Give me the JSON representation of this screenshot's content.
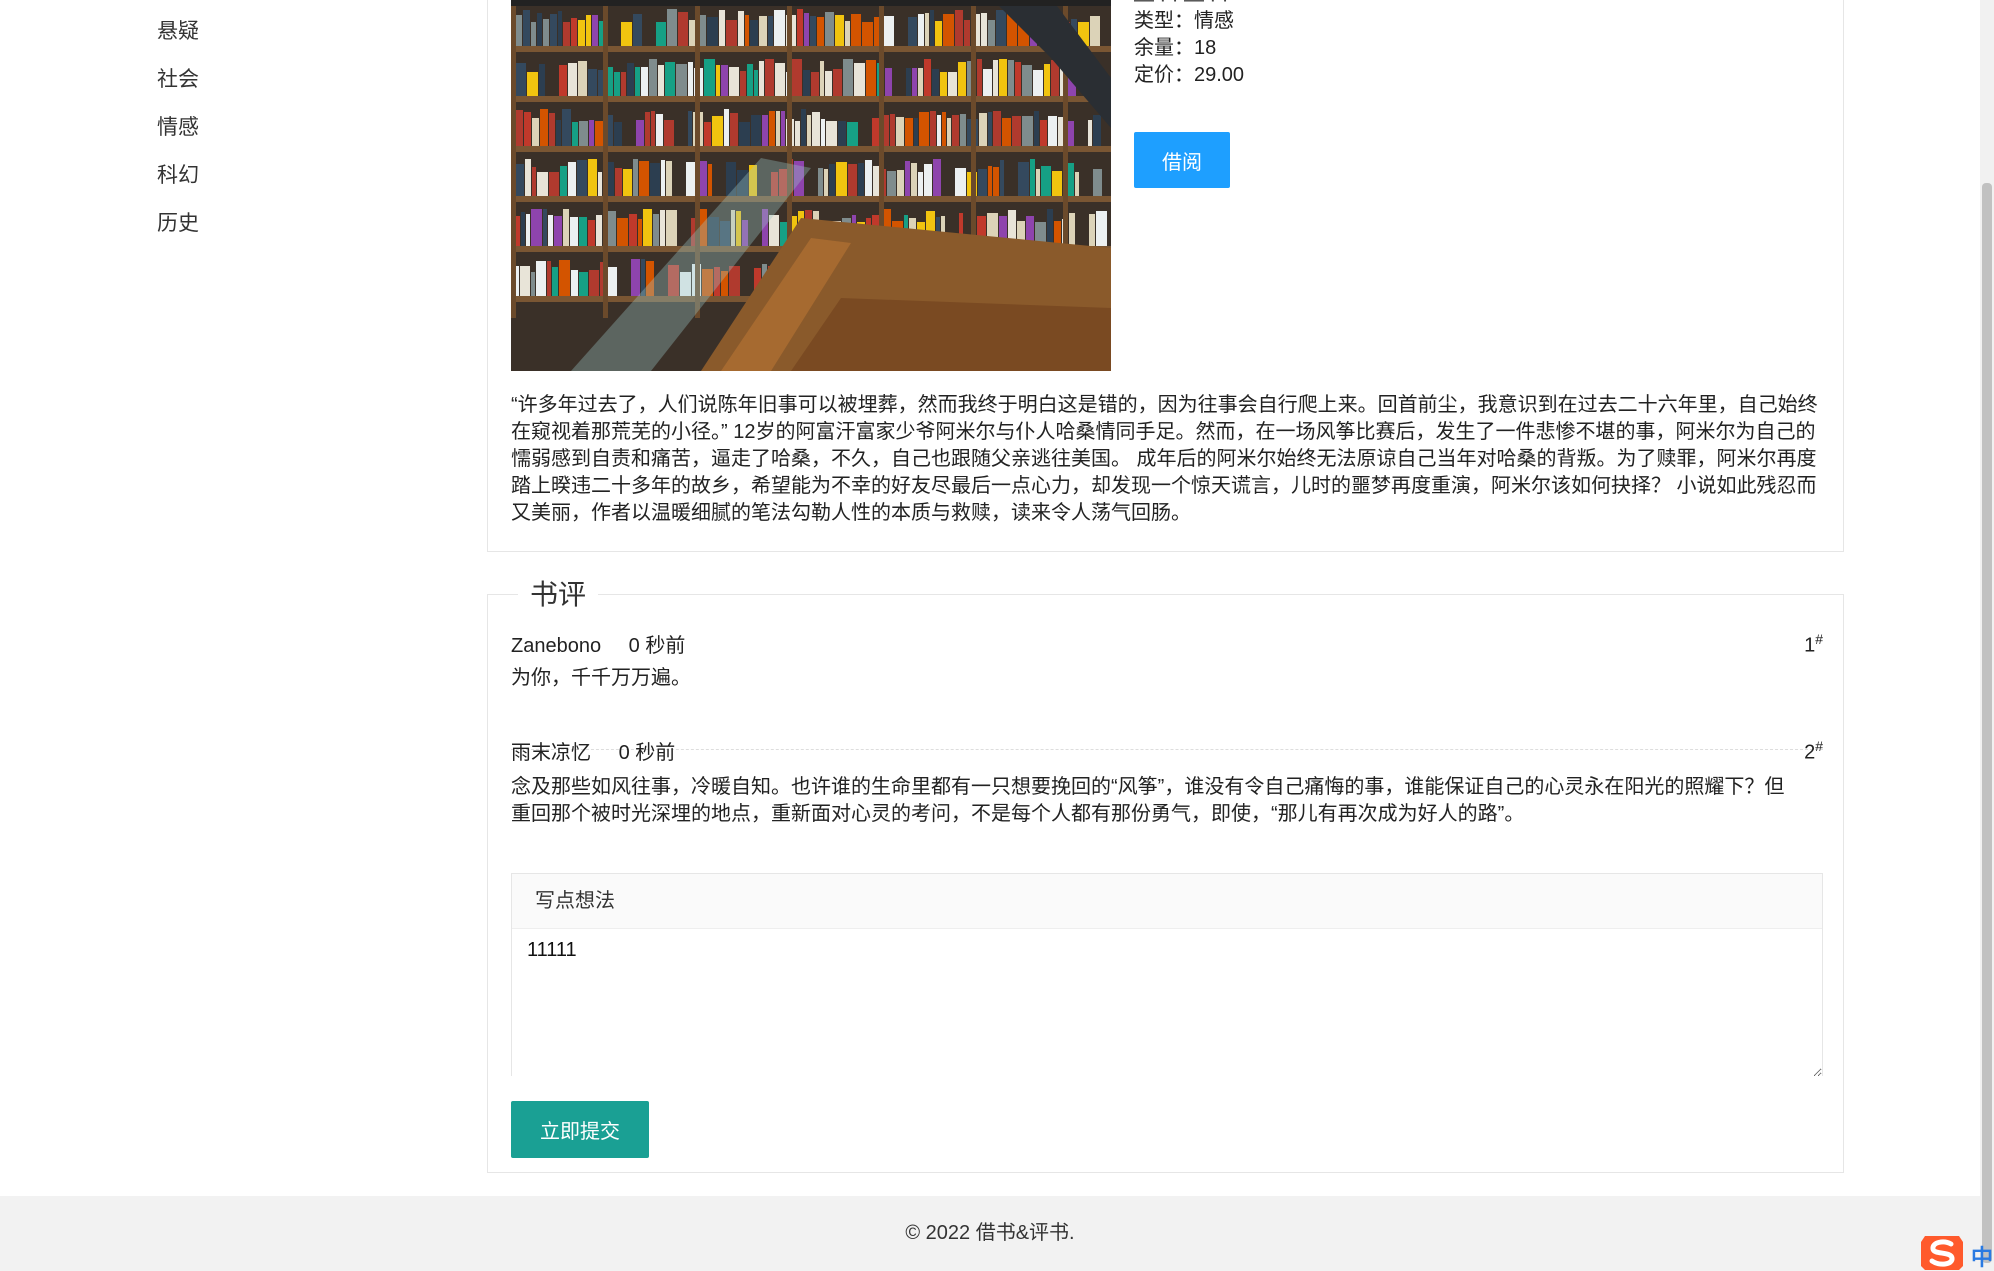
{
  "sidebar": {
    "items": [
      {
        "label": "悬疑"
      },
      {
        "label": "社会"
      },
      {
        "label": "情感"
      },
      {
        "label": "科幻"
      },
      {
        "label": "历史"
      }
    ]
  },
  "book": {
    "type_label": "类型：情感",
    "stock_label": "余量：18",
    "price_label": "定价：29.00",
    "borrow_label": "借阅",
    "description": "“许多年过去了，人们说陈年旧事可以被埋葬，然而我终于明白这是错的，因为往事会自行爬上来。回首前尘，我意识到在过去二十六年里，自己始终在窥视着那荒芜的小径。” 12岁的阿富汗富家少爷阿米尔与仆人哈桑情同手足。然而，在一场风筝比赛后，发生了一件悲惨不堪的事，阿米尔为自己的懦弱感到自责和痛苦，逼走了哈桑，不久，自己也跟随父亲逃往美国。 成年后的阿米尔始终无法原谅自己当年对哈桑的背叛。为了赎罪，阿米尔再度踏上暌违二十多年的故乡，希望能为不幸的好友尽最后一点心力，却发现一个惊天谎言，儿时的噩梦再度重演，阿米尔该如何抉择？ 小说如此残忍而又美丽，作者以温暖细腻的笔法勾勒人性的本质与救赎，读来令人荡气回肠。"
  },
  "reviews": {
    "title": "书评",
    "comments": [
      {
        "author": "Zanebono",
        "time": "0 秒前",
        "floor": "1",
        "mark": "#",
        "text": "为你，千千万万遍。"
      },
      {
        "author": "雨末凉忆",
        "time": "0 秒前",
        "floor": "2",
        "mark": "#",
        "text": "念及那些如风往事，冷暖自知。也许谁的生命里都有一只想要挽回的“风筝”，谁没有令自己痛悔的事，谁能保证自己的心灵永在阳光的照耀下？但重回那个被时光深埋的地点，重新面对心灵的考问，不是每个人都有那份勇气，即使，“那儿有再次成为好人的路”。"
      }
    ],
    "editor_title": "写点想法",
    "editor_value": "11111",
    "submit_label": "立即提交"
  },
  "footer": {
    "text": "© 2022 借书&评书."
  },
  "ime": {
    "char": "中"
  },
  "colors": {
    "primary_blue": "#1e9fff",
    "primary_green": "#1aa094",
    "footer_bg": "#f2f2f2"
  }
}
